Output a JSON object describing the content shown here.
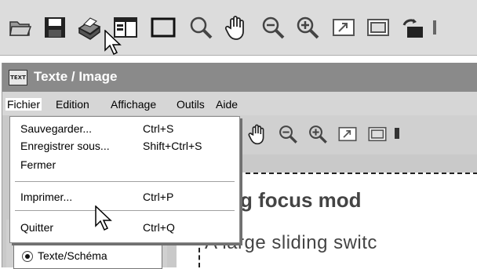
{
  "toolbar": {
    "icons": [
      "open-folder-icon",
      "save-icon",
      "print-icon",
      "layout-panel-icon",
      "rectangle-select-icon",
      "magnifier-icon",
      "hand-icon",
      "zoom-out-icon",
      "zoom-in-icon",
      "fit-icon",
      "window-icon",
      "rotate-icon"
    ]
  },
  "window": {
    "app_icon_text": "TEXT",
    "title": "Texte / Image"
  },
  "menubar": {
    "items": [
      "Fichier",
      "Edition",
      "Affichage",
      "Outils",
      "Aide"
    ]
  },
  "file_menu": {
    "items": [
      {
        "label": "Sauvegarder...",
        "shortcut": "Ctrl+S"
      },
      {
        "label": "Enregistrer sous...",
        "shortcut": "Shift+Ctrl+S"
      },
      {
        "label": "Fermer",
        "shortcut": ""
      },
      {
        "label": "Imprimer...",
        "shortcut": "Ctrl+P"
      },
      {
        "label": "Quitter",
        "shortcut": "Ctrl+Q"
      }
    ]
  },
  "left_panel": {
    "radio_label": "Texte/Schéma"
  },
  "document": {
    "heading_fragment": "ding focus mod",
    "body_fragment": "A large sliding switc"
  }
}
